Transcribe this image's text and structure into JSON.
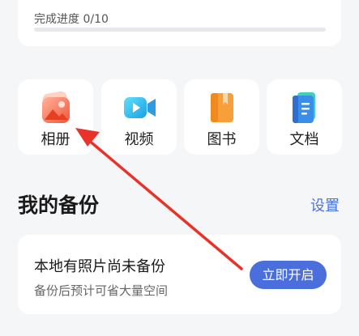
{
  "progress": {
    "label": "完成进度 0/10",
    "fraction": 0.0
  },
  "categories": [
    {
      "label": "相册",
      "icon": "photo-album-icon"
    },
    {
      "label": "视频",
      "icon": "video-camera-icon"
    },
    {
      "label": "图书",
      "icon": "book-icon"
    },
    {
      "label": "文档",
      "icon": "document-icon"
    }
  ],
  "backup_section": {
    "title": "我的备份",
    "settings_label": "设置"
  },
  "backup_card": {
    "title": "本地有照片尚未备份",
    "subtitle": "备份后预计可省大量空间",
    "button_label": "立即开启"
  },
  "colors": {
    "accent": "#4a6fdc",
    "annotation": "#e8322a"
  }
}
